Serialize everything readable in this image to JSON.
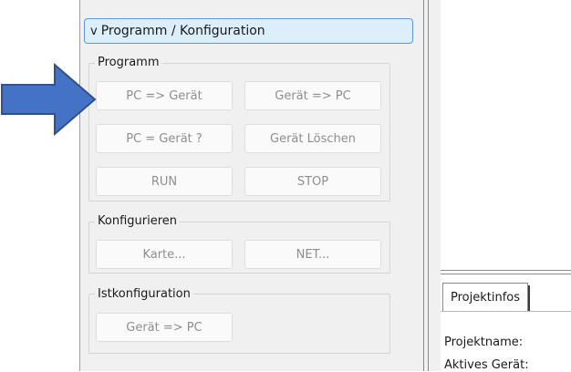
{
  "section": {
    "chevron": "v",
    "title": "Programm / Konfiguration"
  },
  "groups": {
    "programm": {
      "legend": "Programm",
      "buttons": {
        "pc_to_device": "PC => Gerät",
        "device_to_pc": "Gerät => PC",
        "compare": "PC = Gerät ?",
        "delete": "Gerät Löschen",
        "run": "RUN",
        "stop": "STOP"
      }
    },
    "konfigurieren": {
      "legend": "Konfigurieren",
      "buttons": {
        "card": "Karte...",
        "net": "NET..."
      }
    },
    "istkonfiguration": {
      "legend": "Istkonfiguration",
      "buttons": {
        "device_to_pc": "Gerät => PC"
      }
    }
  },
  "right": {
    "tab_label": "Projektinfos",
    "project_name_label": "Projektname:",
    "active_device_label": "Aktives Gerät:"
  },
  "colors": {
    "accent_arrow": "#4472c4",
    "header_bg": "#dbeefa",
    "header_border": "#5a9ad6"
  },
  "icons": {
    "pointer": "right-arrow-icon",
    "expand": "chevron-down-icon"
  }
}
